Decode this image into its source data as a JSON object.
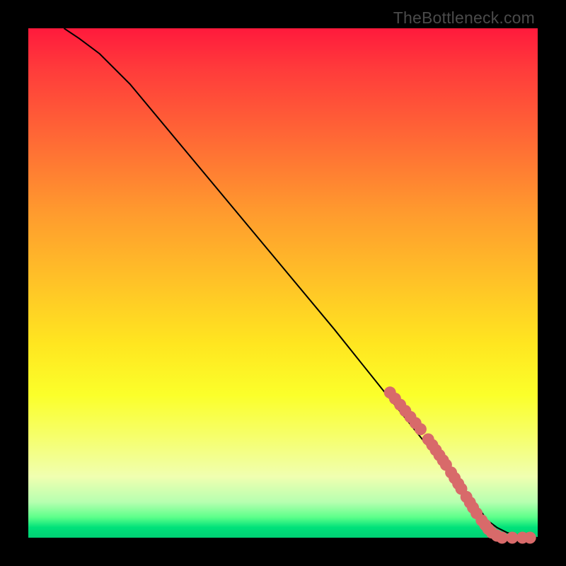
{
  "watermark": "TheBottleneck.com",
  "colors": {
    "frame": "#000000",
    "dot": "#d86a6a",
    "line": "#000000"
  },
  "chart_data": {
    "type": "line",
    "title": "",
    "xlabel": "",
    "ylabel": "",
    "xlim": [
      0,
      100
    ],
    "ylim": [
      0,
      100
    ],
    "grid": false,
    "legend": false,
    "series": [
      {
        "name": "curve",
        "x": [
          7,
          10,
          14,
          20,
          30,
          40,
          50,
          60,
          68,
          72,
          76,
          80,
          83,
          85,
          87,
          89,
          90,
          92,
          94,
          96,
          98,
          100
        ],
        "y": [
          100,
          98,
          95,
          89,
          77,
          65,
          53,
          41,
          31,
          26,
          21,
          16,
          12,
          9,
          7,
          5,
          3.5,
          2,
          1,
          0.5,
          0.2,
          0
        ]
      }
    ],
    "scatter": [
      {
        "name": "dots",
        "points": [
          [
            71,
            28.5
          ],
          [
            72,
            27.3
          ],
          [
            73,
            26.1
          ],
          [
            74,
            24.9
          ],
          [
            75,
            23.7
          ],
          [
            76,
            22.5
          ],
          [
            77,
            21.3
          ],
          [
            78.5,
            19.3
          ],
          [
            79.3,
            18.2
          ],
          [
            80,
            17.2
          ],
          [
            80.7,
            16.2
          ],
          [
            81.4,
            15.2
          ],
          [
            82,
            14.3
          ],
          [
            83,
            12.8
          ],
          [
            83.7,
            11.7
          ],
          [
            84.4,
            10.6
          ],
          [
            85,
            9.6
          ],
          [
            86,
            8.0
          ],
          [
            86.7,
            6.9
          ],
          [
            87.3,
            5.9
          ],
          [
            88,
            4.8
          ],
          [
            89,
            3.4
          ],
          [
            89.7,
            2.5
          ],
          [
            90.3,
            1.7
          ],
          [
            91,
            1.0
          ],
          [
            92,
            0.4
          ],
          [
            93,
            0.0
          ],
          [
            95,
            0.0
          ],
          [
            97,
            0.0
          ],
          [
            98.5,
            0.0
          ]
        ]
      }
    ]
  }
}
